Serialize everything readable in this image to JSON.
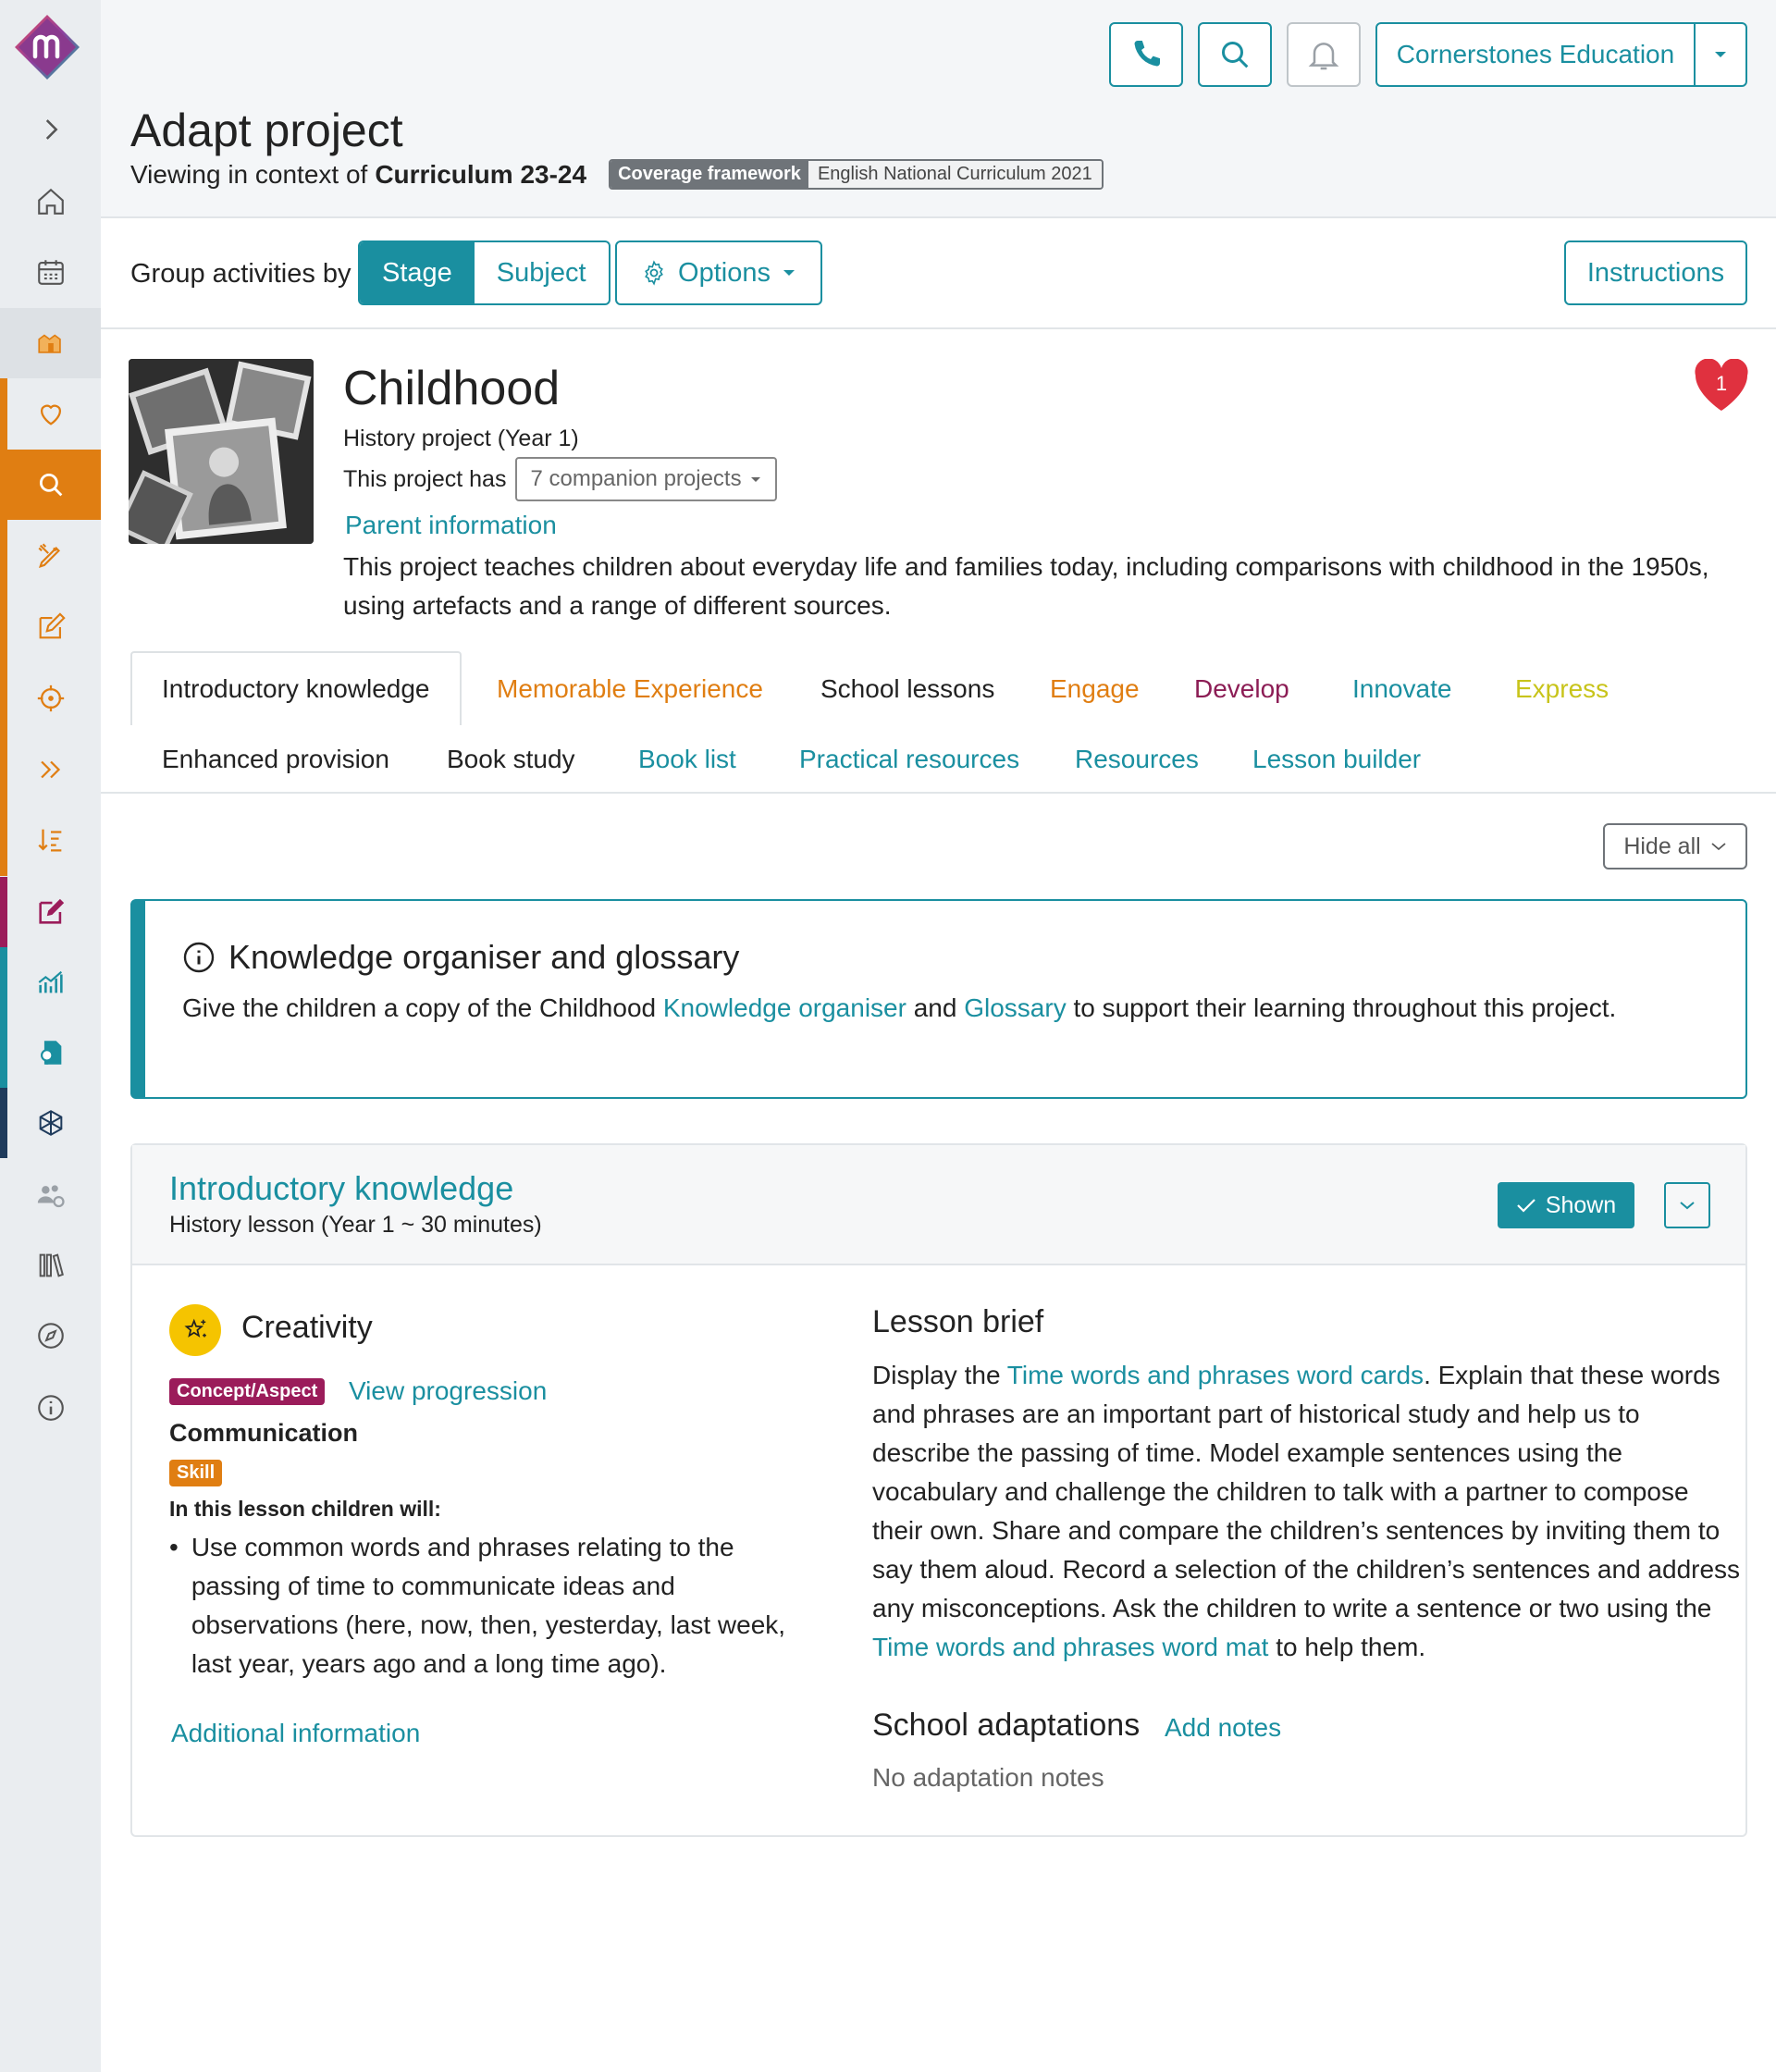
{
  "header": {
    "org_name": "Cornerstones Education",
    "page_title": "Adapt project",
    "context_prefix": "Viewing in context of",
    "context_name": "Curriculum 23-24",
    "framework_key": "Coverage framework",
    "framework_value": "English National Curriculum 2021"
  },
  "groupbar": {
    "label": "Group activities by",
    "options": [
      "Stage",
      "Subject"
    ],
    "selected": "Stage",
    "options_button": "Options",
    "instructions_button": "Instructions"
  },
  "project": {
    "title": "Childhood",
    "subtitle": "History project (Year 1)",
    "has_label": "This project has",
    "companion": "7 companion projects",
    "parent_link": "Parent information",
    "description": "This project teaches children about everyday life and families today, including comparisons with childhood in the 1950s, using artefacts and a range of different sources.",
    "favourite_count": "1"
  },
  "tabs": [
    {
      "label": "Introductory knowledge",
      "color": "#222222"
    },
    {
      "label": "Memorable Experience",
      "color": "#e07e12"
    },
    {
      "label": "School lessons",
      "color": "#222222"
    },
    {
      "label": "Engage",
      "color": "#e07e12"
    },
    {
      "label": "Develop",
      "color": "#8c1d55"
    },
    {
      "label": "Innovate",
      "color": "#1a8fa0"
    },
    {
      "label": "Express",
      "color": "#c8c41b"
    },
    {
      "label": "Enhanced provision",
      "color": "#222222"
    },
    {
      "label": "Book study",
      "color": "#222222"
    },
    {
      "label": "Book list",
      "color": "#1a8fa0"
    },
    {
      "label": "Practical resources",
      "color": "#1a8fa0"
    },
    {
      "label": "Resources",
      "color": "#1a8fa0"
    },
    {
      "label": "Lesson builder",
      "color": "#1a8fa0"
    }
  ],
  "hide_all": "Hide all",
  "info_box": {
    "title": "Knowledge organiser and glossary",
    "text_before": "Give the children a copy of the Childhood ",
    "link1": "Knowledge organiser",
    "text_mid": " and ",
    "link2": "Glossary",
    "text_after": " to support their learning throughout this project."
  },
  "lesson": {
    "title": "Introductory knowledge",
    "subtitle": "History lesson (Year 1 ~ 30 minutes)",
    "shown_label": "Shown",
    "theme": "Creativity",
    "concept_badge": "Concept/Aspect",
    "view_progression": "View progression",
    "concept": "Communication",
    "skill_badge": "Skill",
    "in_lesson": "In this lesson children will:",
    "objective": "Use common words and phrases relating to the passing of time to communicate ideas and observations (here, now, then, yesterday, last week, last year, years ago and a long time ago).",
    "additional_info": "Additional information",
    "brief_title": "Lesson brief",
    "brief_1": "Display the ",
    "brief_link1": "Time words and phrases word cards",
    "brief_2": ". Explain that these words and phrases are an important part of historical study and help us to describe the passing of time. Model example sentences using the vocabulary and challenge the children to talk with a partner to compose their own. Share and compare the children’s sentences by inviting them to say them aloud. Record a selection of the children’s sentences and address any misconceptions. Ask the children to write a sentence or two using the ",
    "brief_link2": "Time words and phrases word mat",
    "brief_3": " to help them.",
    "adapt_title": "School adaptations",
    "add_notes": "Add notes",
    "no_notes": "No adaptation notes"
  },
  "colors": {
    "accent": "#1a8fa0",
    "orange": "#e07e12",
    "concept": "#9b1c5a",
    "creativity": "#f5c400"
  }
}
